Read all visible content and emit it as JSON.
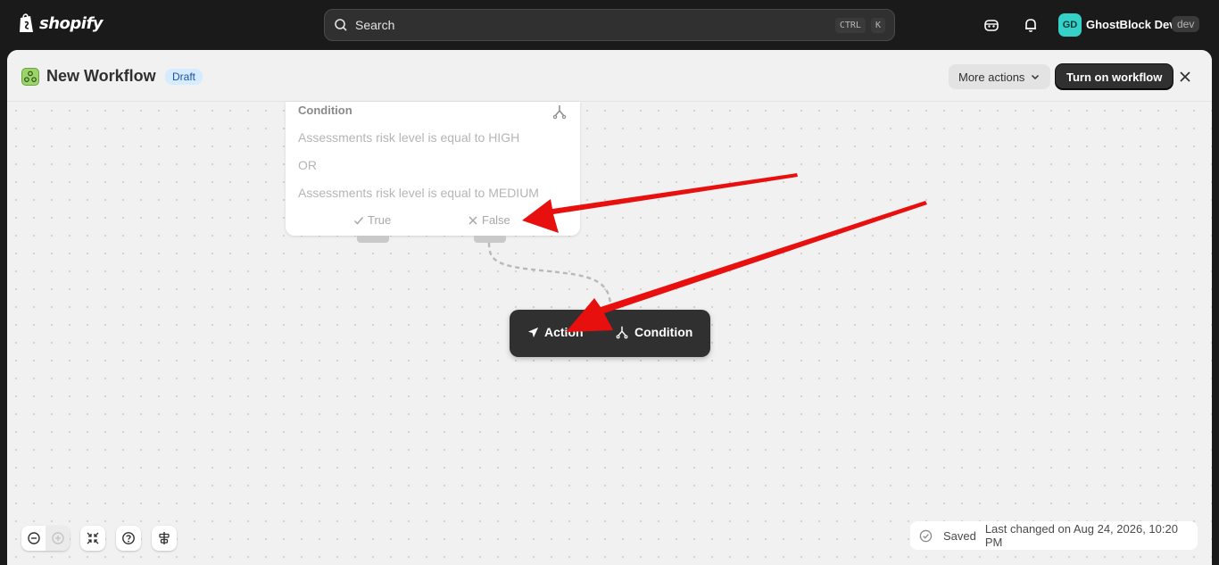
{
  "topbar": {
    "brand": "shopify",
    "search_placeholder": "Search",
    "shortcut_key1": "CTRL",
    "shortcut_key2": "K",
    "avatar_initials": "GD",
    "store_name": "GhostBlock Dev",
    "store_badge": "dev"
  },
  "header": {
    "title": "New Workflow",
    "status": "Draft",
    "more_actions": "More actions",
    "turn_on": "Turn on workflow"
  },
  "condition_card": {
    "title": "Condition",
    "line1": "Assessments risk level is equal to HIGH",
    "operator": "OR",
    "line2": "Assessments risk level is equal to MEDIUM",
    "true_label": "True",
    "false_label": "False"
  },
  "add_popover": {
    "action_label": "Action",
    "condition_label": "Condition"
  },
  "status_bar": {
    "saved": "Saved",
    "last_changed": "Last changed on Aug 24, 2026, 10:20 PM"
  },
  "colors": {
    "accent_dark": "#303030",
    "draft_bg": "#d5ebff",
    "avatar": "#35d0c8",
    "annotation_arrow": "#e8100f"
  }
}
